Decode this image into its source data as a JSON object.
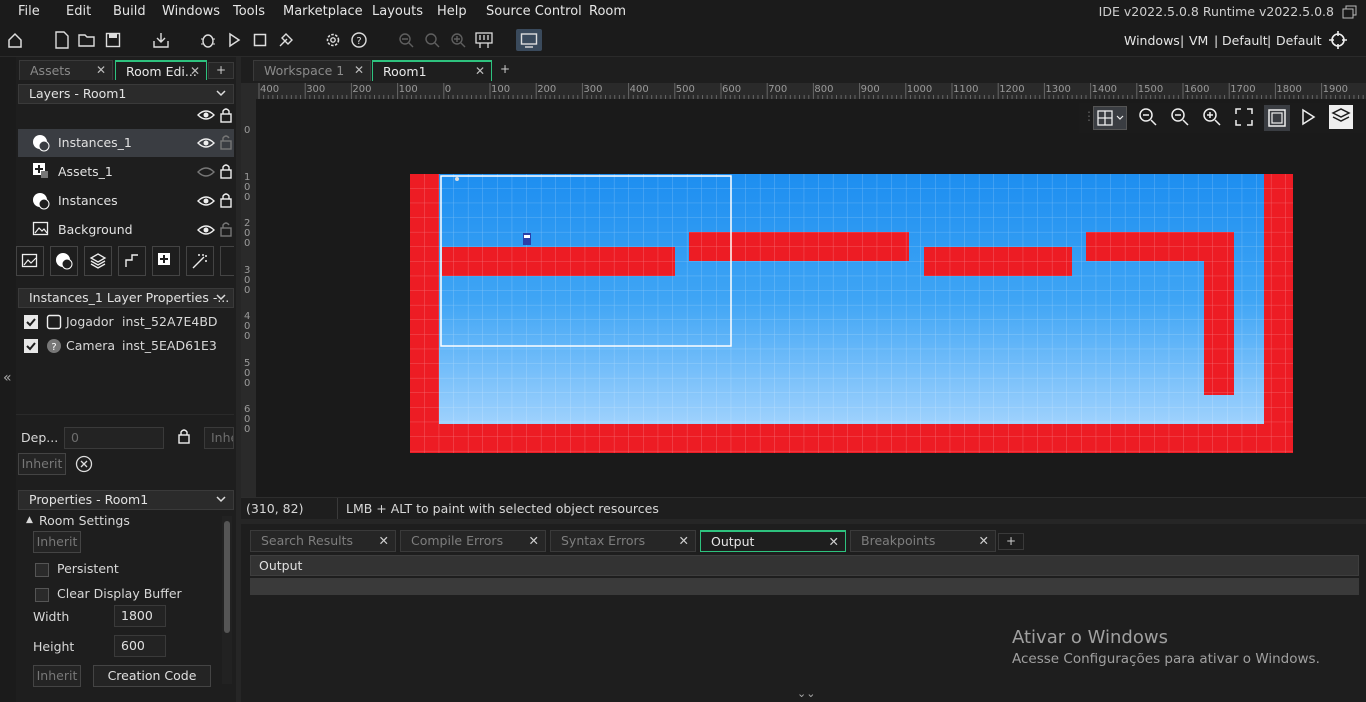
{
  "menu": [
    "File",
    "Edit",
    "Build",
    "Windows",
    "Tools",
    "Marketplace",
    "Layouts",
    "Help",
    "Source Control",
    "Room"
  ],
  "version_label": "IDE v2022.5.0.8  Runtime v2022.5.0.8",
  "target": {
    "platform": "Windows",
    "sep": "|",
    "vm": "VM",
    "config1": "Default",
    "config2": "Default"
  },
  "left_tabs": [
    {
      "label": "Assets",
      "active": false
    },
    {
      "label": "Room Edi...",
      "active": true
    }
  ],
  "layers_dropdown": "Layers - Room1",
  "layers": [
    {
      "name": "Instances_1",
      "icon": "instance-layer-icon",
      "visible": true,
      "locked": false,
      "selected": true
    },
    {
      "name": "Assets_1",
      "icon": "asset-layer-icon",
      "visible": false,
      "locked": true,
      "selected": false
    },
    {
      "name": "Instances",
      "icon": "instance-layer-icon",
      "visible": true,
      "locked": true,
      "selected": false
    },
    {
      "name": "Background",
      "icon": "background-layer-icon",
      "visible": true,
      "locked": false,
      "selected": false
    }
  ],
  "layer_props_dropdown": "Instances_1 Layer Properties -...",
  "instances": [
    {
      "object": "Jogador",
      "id": "inst_52A7E4BD",
      "checked": true,
      "icon": "sprite-icon"
    },
    {
      "object": "Camera",
      "id": "inst_5EAD61E3",
      "checked": true,
      "icon": "question-icon"
    }
  ],
  "depth": {
    "label": "Dep...",
    "value": "0",
    "inherit_field": "Inhe",
    "inherit_button": "Inherit"
  },
  "properties_dropdown": "Properties - Room1",
  "room_settings": {
    "header": "Room Settings",
    "inherit": "Inherit",
    "persistent_label": "Persistent",
    "persistent": false,
    "clear_label": "Clear Display Buffer",
    "clear": false,
    "width_label": "Width",
    "width": "1800",
    "height_label": "Height",
    "height": "600",
    "inherit2": "Inherit",
    "creation_code": "Creation Code"
  },
  "editor_tabs": [
    {
      "label": "Workspace 1",
      "active": false
    },
    {
      "label": "Room1",
      "active": true
    }
  ],
  "ruler_h": [
    "400",
    "300",
    "200",
    "100",
    "0",
    "100",
    "200",
    "300",
    "400",
    "500",
    "600",
    "700",
    "800",
    "900",
    "1000",
    "1100",
    "1200",
    "1300",
    "1400",
    "1500",
    "1600",
    "1700",
    "1800",
    "1900"
  ],
  "ruler_v": [
    "100",
    "0",
    "100",
    "200",
    "300",
    "400",
    "500",
    "600"
  ],
  "status": {
    "coords": "(310, 82)",
    "hint": "LMB + ALT to paint with selected object resources"
  },
  "bottom_tabs": [
    {
      "label": "Search Results",
      "active": false
    },
    {
      "label": "Compile Errors",
      "active": false
    },
    {
      "label": "Syntax Errors",
      "active": false
    },
    {
      "label": "Output",
      "active": true
    },
    {
      "label": "Breakpoints",
      "active": false
    }
  ],
  "output_header": "Output",
  "watermark": {
    "title": "Ativar o Windows",
    "subtitle": "Acesse Configurações para ativar o Windows."
  },
  "colors": {
    "wall": "#ed1c24",
    "sky_top": "#2196f3",
    "sky_bottom": "#9fd3ff",
    "accent": "#2ec27e"
  }
}
